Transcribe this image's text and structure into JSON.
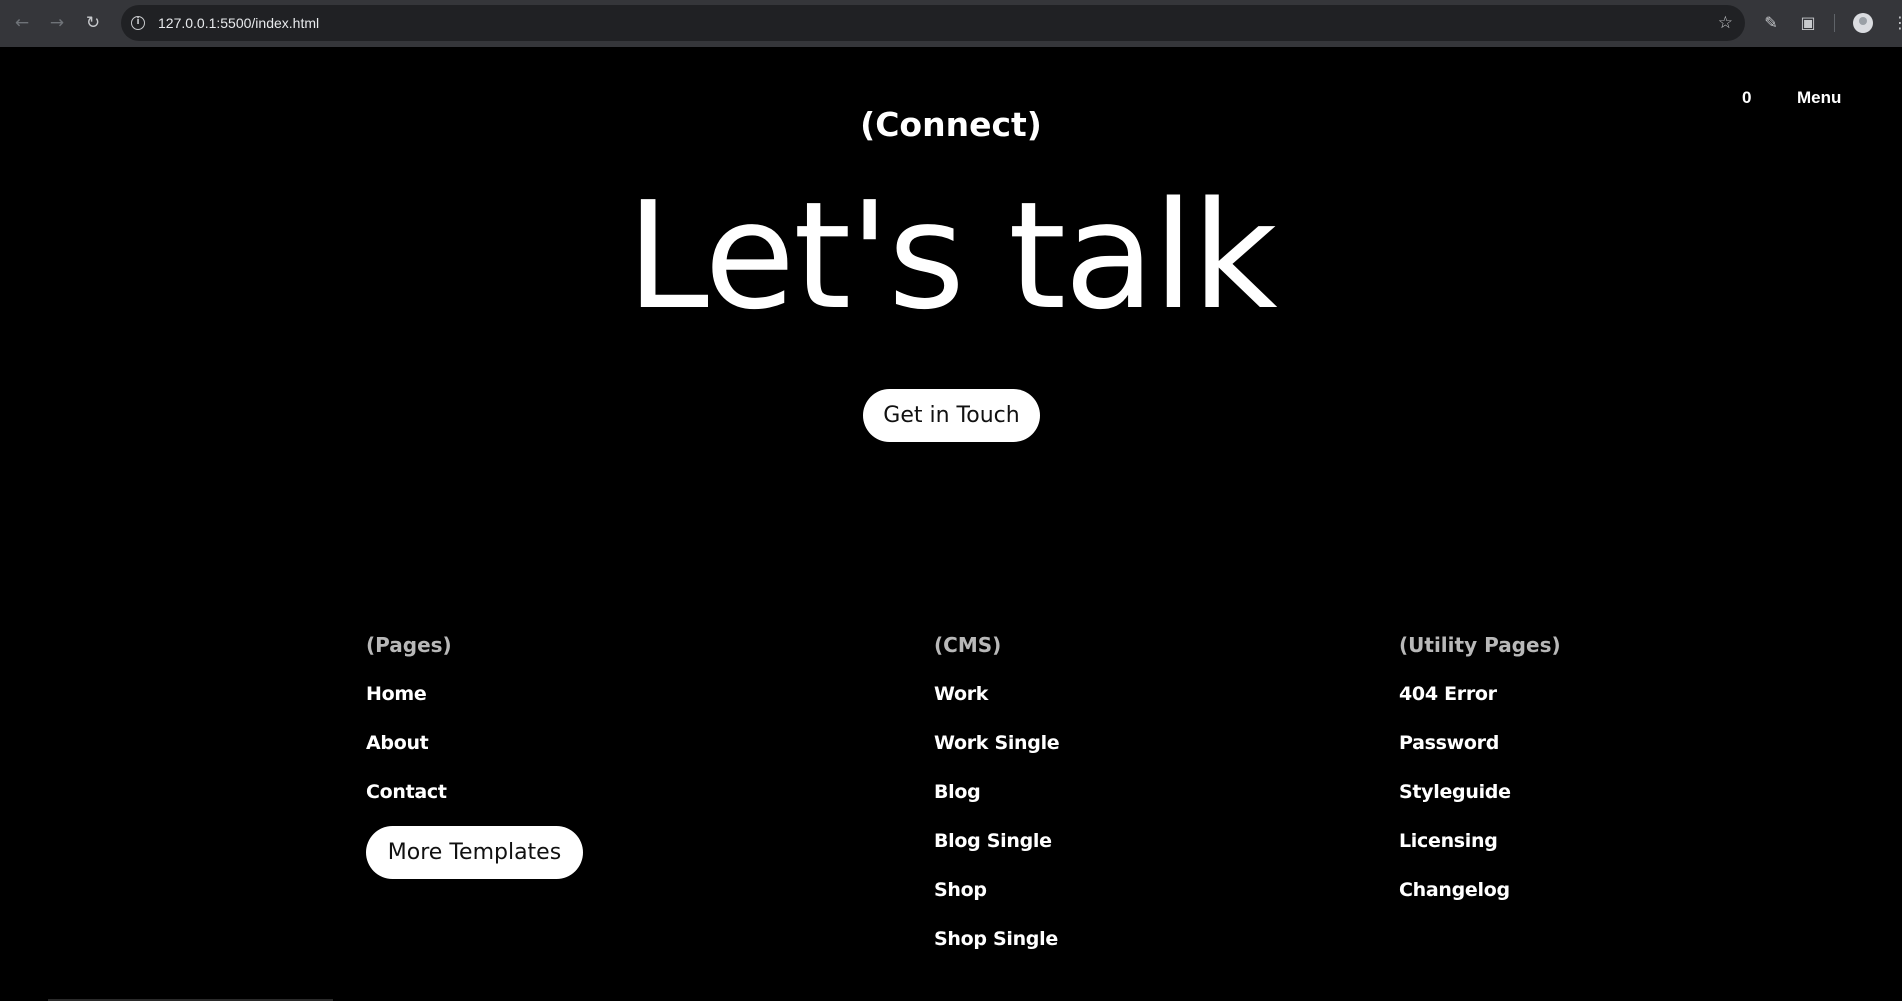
{
  "browser": {
    "url": "127.0.0.1:5500/index.html",
    "icons": {
      "back": "arrow-left-icon",
      "forward": "arrow-right-icon",
      "reload": "reload-icon",
      "info": "info-icon",
      "bookmark": "star-icon",
      "pen": "pen-icon",
      "extensions": "puzzle-icon",
      "profile": "avatar",
      "menu": "kebab-icon"
    }
  },
  "header": {
    "cart_count": "0",
    "menu_label": "Menu"
  },
  "hero": {
    "eyebrow": "(Connect)",
    "headline": "Let's talk",
    "cta_label": "Get in Touch"
  },
  "footer": {
    "pages": {
      "heading": "(Pages)",
      "links": [
        "Home",
        "About",
        "Contact"
      ],
      "button_label": "More Templates"
    },
    "cms": {
      "heading": "(CMS)",
      "links": [
        "Work",
        "Work Single",
        "Blog",
        "Blog Single",
        "Shop",
        "Shop Single"
      ]
    },
    "utility": {
      "heading": "(Utility Pages)",
      "links": [
        "404 Error",
        "Password",
        "Styleguide",
        "Licensing",
        "Changelog"
      ]
    }
  },
  "colors": {
    "background": "#000000",
    "text": "#ffffff",
    "muted_heading": "#b8b8b8",
    "pill_background": "#ffffff"
  }
}
